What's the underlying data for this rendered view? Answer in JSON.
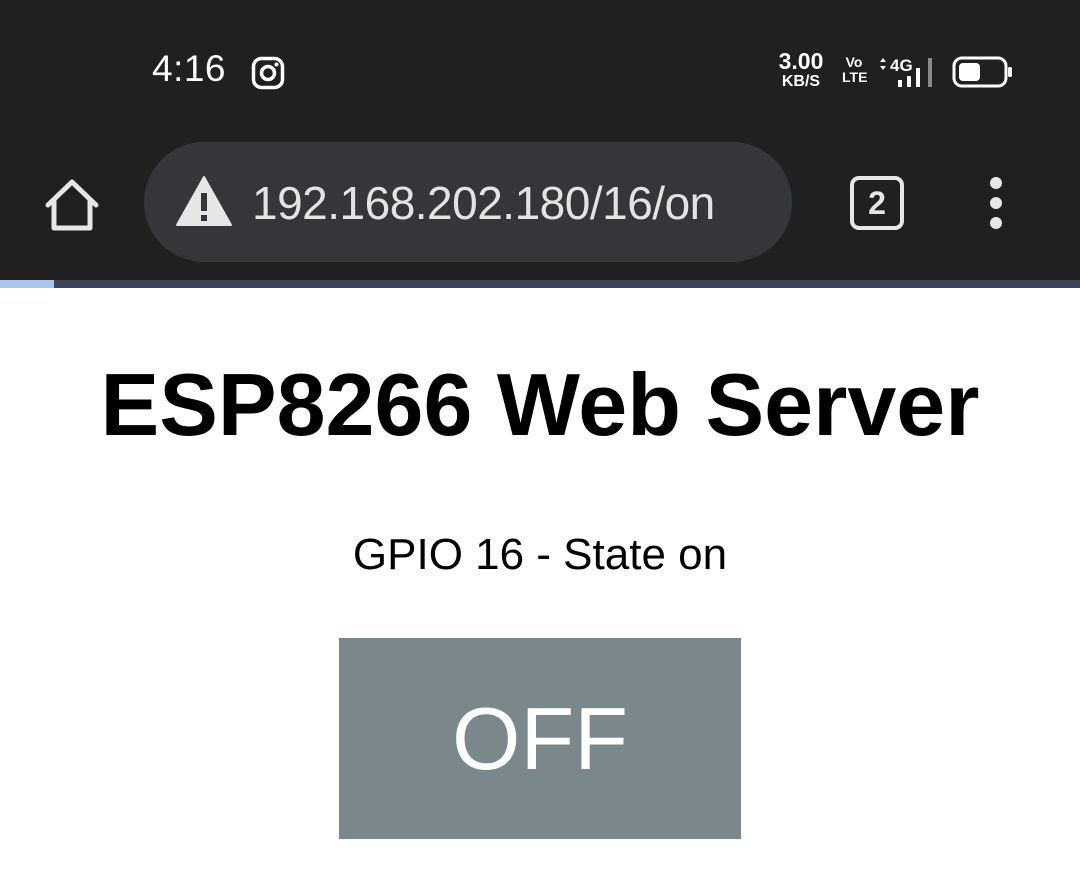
{
  "status_bar": {
    "time": "4:16",
    "notification_icon": "instagram-icon",
    "net_speed_value": "3.00",
    "net_speed_unit": "KB/S",
    "volte_top": "Vo",
    "volte_bottom": "LTE",
    "network_type": "4G",
    "battery_level": 0.5
  },
  "browser": {
    "home_icon": "home-icon",
    "security_icon": "warning-icon",
    "url": "192.168.202.180/16/on",
    "tab_count": "2",
    "menu_icon": "more-vertical-icon",
    "load_progress": 0.05
  },
  "page": {
    "title": "ESP8266 Web Server",
    "gpio_state": "GPIO 16 - State on",
    "button_label": "OFF"
  },
  "colors": {
    "chrome_bg": "#202020",
    "url_box_bg": "#35363a",
    "button_bg": "#7a888b",
    "progress_fill": "#a8c4f0"
  }
}
